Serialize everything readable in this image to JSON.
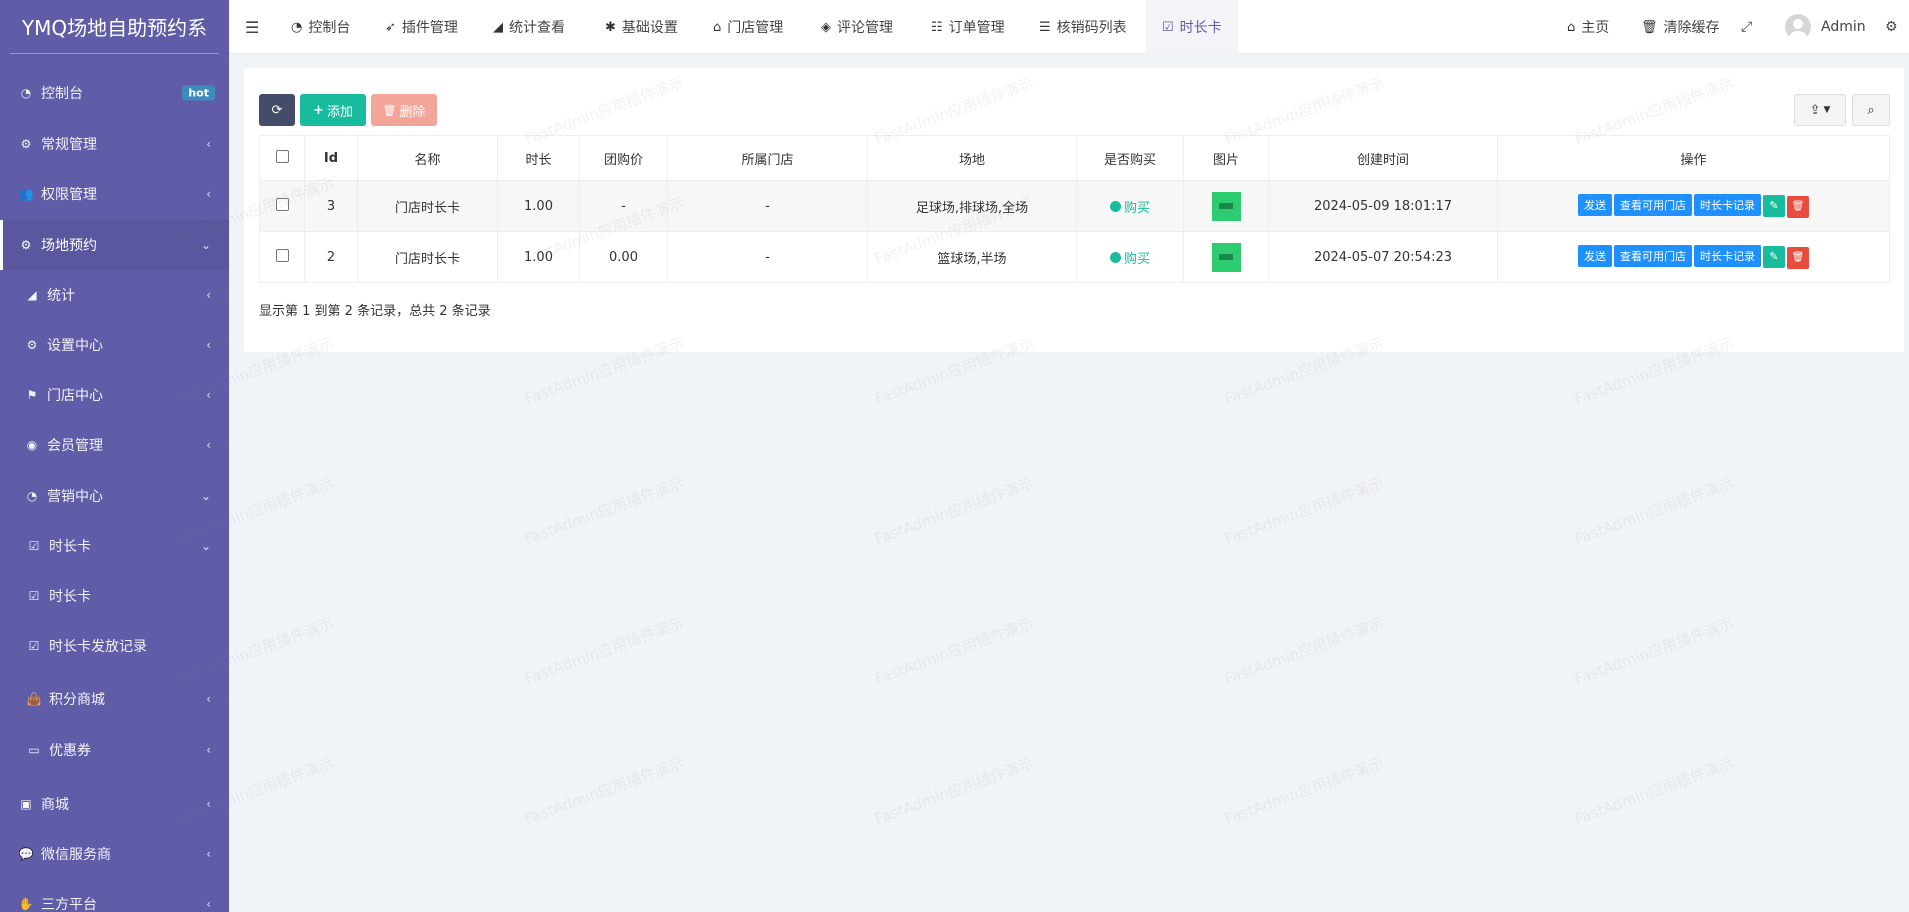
{
  "brand": "YMQ场地自助预约系",
  "sidebar": {
    "items": [
      {
        "label": "控制台",
        "badge": "hot"
      },
      {
        "label": "常规管理"
      },
      {
        "label": "权限管理"
      },
      {
        "label": "场地预约"
      },
      {
        "label": "统计"
      },
      {
        "label": "设置中心"
      },
      {
        "label": "门店中心"
      },
      {
        "label": "会员管理"
      },
      {
        "label": "营销中心"
      },
      {
        "label": "时长卡"
      },
      {
        "label": "时长卡"
      },
      {
        "label": "时长卡发放记录"
      },
      {
        "label": "积分商城"
      },
      {
        "label": "优惠券"
      },
      {
        "label": "商城"
      },
      {
        "label": "微信服务商"
      },
      {
        "label": "三方平台"
      }
    ]
  },
  "topnav": {
    "items": [
      "控制台",
      "插件管理",
      "统计查看",
      "基础设置",
      "门店管理",
      "评论管理",
      "订单管理",
      "核销码列表",
      "时长卡"
    ],
    "home": "主页",
    "clear_cache": "清除缓存",
    "user": "Admin"
  },
  "toolbar": {
    "add": "添加",
    "delete": "删除"
  },
  "table": {
    "headers": [
      "Id",
      "名称",
      "时长",
      "团购价",
      "所属门店",
      "场地",
      "是否购买",
      "图片",
      "创建时间",
      "操作"
    ],
    "rows": [
      {
        "id": "3",
        "name": "门店时长卡",
        "duration": "1.00",
        "group_price": "-",
        "store": "-",
        "venue": "足球场,排球场,全场",
        "buy": "购买",
        "created": "2024-05-09 18:01:17"
      },
      {
        "id": "2",
        "name": "门店时长卡",
        "duration": "1.00",
        "group_price": "0.00",
        "store": "-",
        "venue": "篮球场,半场",
        "buy": "购买",
        "created": "2024-05-07 20:54:23"
      }
    ],
    "ops": {
      "send": "发送",
      "view_stores": "查看可用门店",
      "records": "时长卡记录"
    }
  },
  "footer": "显示第 1 到第 2 条记录，总共 2 条记录",
  "watermark": "FastAdmin应用插件演示",
  "colors": {
    "sidebar": "#605ca8",
    "accent": "#18bc9c",
    "danger": "#e74c3c",
    "primary": "#1e90ff"
  }
}
